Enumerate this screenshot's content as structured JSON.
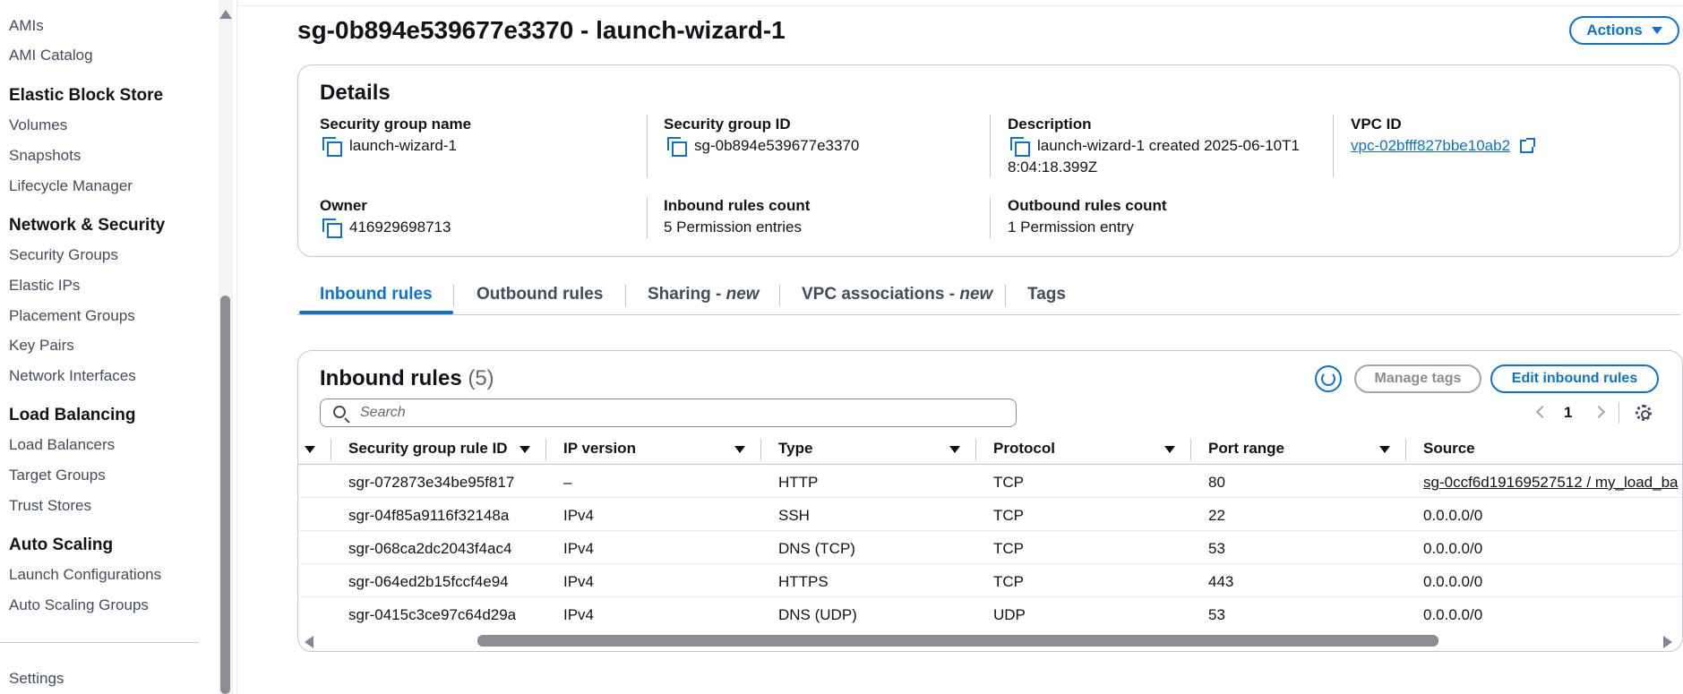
{
  "sidebar": {
    "items": [
      {
        "label": "AMIs"
      },
      {
        "label": "AMI Catalog"
      },
      {
        "label": "Elastic Block Store"
      },
      {
        "label": "Volumes"
      },
      {
        "label": "Snapshots"
      },
      {
        "label": "Lifecycle Manager"
      },
      {
        "label": "Network & Security"
      },
      {
        "label": "Security Groups"
      },
      {
        "label": "Elastic IPs"
      },
      {
        "label": "Placement Groups"
      },
      {
        "label": "Key Pairs"
      },
      {
        "label": "Network Interfaces"
      },
      {
        "label": "Load Balancing"
      },
      {
        "label": "Load Balancers"
      },
      {
        "label": "Target Groups"
      },
      {
        "label": "Trust Stores"
      },
      {
        "label": "Auto Scaling"
      },
      {
        "label": "Launch Configurations"
      },
      {
        "label": "Auto Scaling Groups"
      },
      {
        "label": "Settings"
      }
    ]
  },
  "header": {
    "title": "sg-0b894e539677e3370 - launch-wizard-1",
    "actions_label": "Actions"
  },
  "details": {
    "title": "Details",
    "sg_name_label": "Security group name",
    "sg_name_value": "launch-wizard-1",
    "sg_id_label": "Security group ID",
    "sg_id_value": "sg-0b894e539677e3370",
    "description_label": "Description",
    "description_line1": "launch-wizard-1 created 2025-06-10T1",
    "description_line2": "8:04:18.399Z",
    "vpc_label": "VPC ID",
    "vpc_value": "vpc-02bfff827bbe10ab2",
    "owner_label": "Owner",
    "owner_value": "416929698713",
    "inbound_count_label": "Inbound rules count",
    "inbound_count_value": "5 Permission entries",
    "outbound_count_label": "Outbound rules count",
    "outbound_count_value": "1 Permission entry"
  },
  "tabs": {
    "inbound": "Inbound rules",
    "outbound": "Outbound rules",
    "sharing": "Sharing - ",
    "sharing_new": "new",
    "vpc_assoc": "VPC associations - ",
    "vpc_assoc_new": "new",
    "tags": "Tags"
  },
  "inbound_rules": {
    "title": "Inbound rules",
    "count": "(5)",
    "manage_tags_label": "Manage tags",
    "edit_label": "Edit inbound rules",
    "search_placeholder": "Search",
    "page": "1",
    "columns": [
      "Security group rule ID",
      "IP version",
      "Type",
      "Protocol",
      "Port range",
      "Source"
    ],
    "rows": [
      {
        "id": "sgr-072873e34be95f817",
        "ip": "–",
        "type": "HTTP",
        "protocol": "TCP",
        "port": "80",
        "source": "sg-0ccf6d19169527512 / my_load_ba"
      },
      {
        "id": "sgr-04f85a9116f32148a",
        "ip": "IPv4",
        "type": "SSH",
        "protocol": "TCP",
        "port": "22",
        "source": "0.0.0.0/0"
      },
      {
        "id": "sgr-068ca2dc2043f4ac4",
        "ip": "IPv4",
        "type": "DNS (TCP)",
        "protocol": "TCP",
        "port": "53",
        "source": "0.0.0.0/0"
      },
      {
        "id": "sgr-064ed2b15fccf4e94",
        "ip": "IPv4",
        "type": "HTTPS",
        "protocol": "TCP",
        "port": "443",
        "source": "0.0.0.0/0"
      },
      {
        "id": "sgr-0415c3ce97c64d29a",
        "ip": "IPv4",
        "type": "DNS (UDP)",
        "protocol": "UDP",
        "port": "53",
        "source": "0.0.0.0/0"
      }
    ]
  },
  "colors": {
    "accent": "#0972d3",
    "text": "#0f141a",
    "border": "#c6c6cd"
  }
}
